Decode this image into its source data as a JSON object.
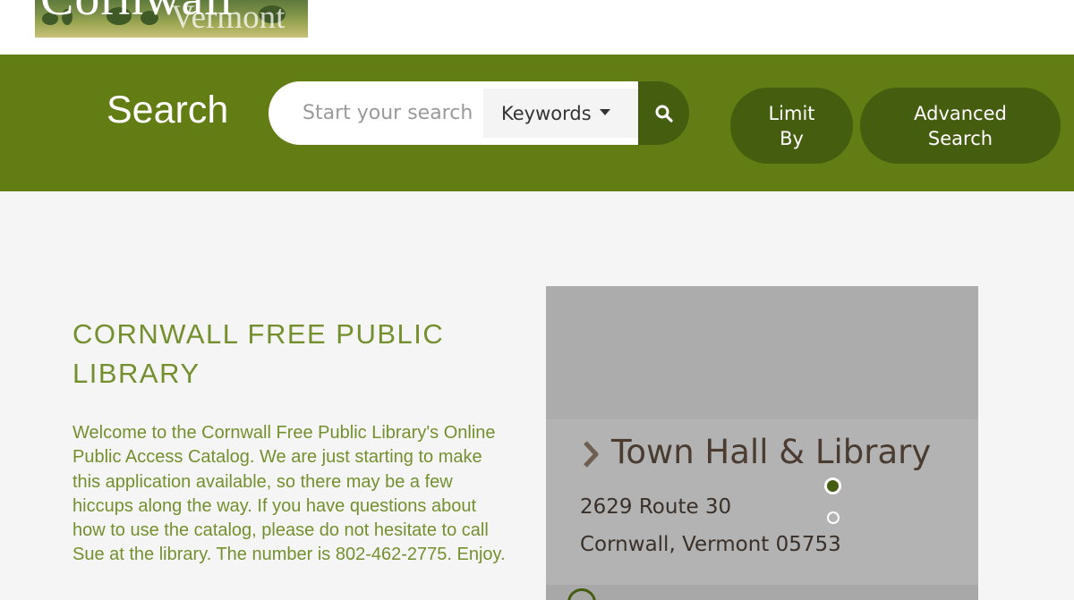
{
  "header": {
    "logo": {
      "town": "Cornwall",
      "state": "Vermont"
    }
  },
  "search": {
    "title": "Search",
    "placeholder": "Start your search",
    "type_selected": "Keywords",
    "limit_label": "Limit\nBy",
    "advanced_label": "Advanced\nSearch",
    "button_icon": "search-icon"
  },
  "main": {
    "title": "CORNWALL FREE PUBLIC LIBRARY",
    "welcome": "Welcome to the Cornwall Free Public Library's Online Public Access Catalog. We are just starting to make this application available, so there may be a few hiccups along the way. If you have questions about how to use the catalog, please do not hesitate to call Sue at the library. The number is 802-462-2775. Enjoy."
  },
  "location": {
    "heading": "Town Hall & Library",
    "address_line1": "2629 Route 30",
    "address_line2": "Cornwall, Vermont 05753",
    "chevron_icon": "chevron-right-icon",
    "slides": {
      "count": 2,
      "active": 1
    }
  },
  "colors": {
    "brand_green": "#617d14",
    "dark_green": "#445d0f",
    "title_green": "#74902e",
    "panel_gray": "#b3b3b3"
  }
}
